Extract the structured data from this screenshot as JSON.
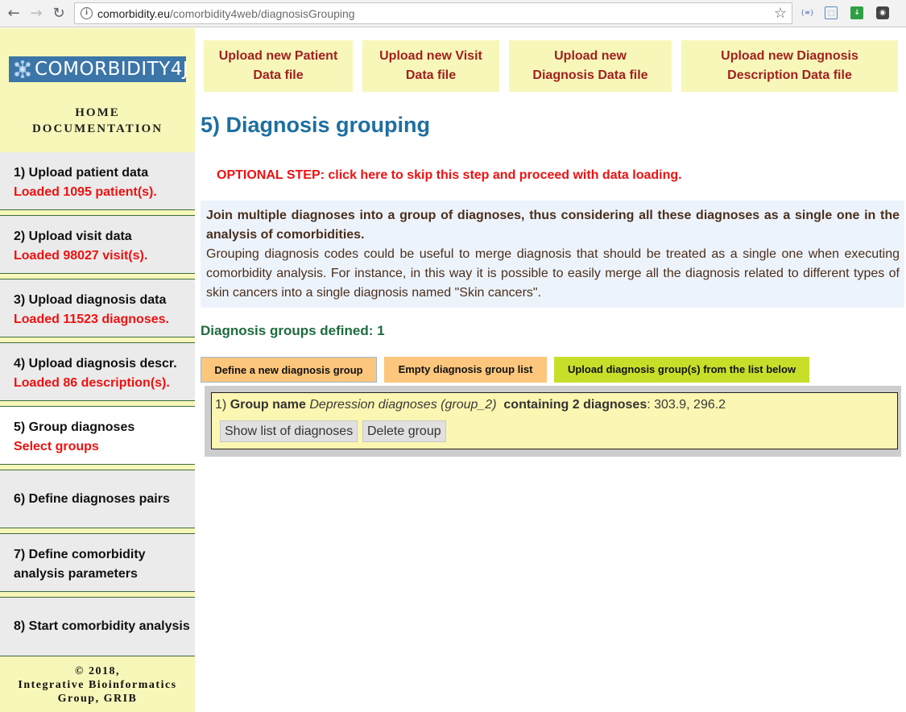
{
  "browser": {
    "url_domain": "comorbidity.eu",
    "url_path": "/comorbidity4web/diagnosisGrouping",
    "ext1_label": "{≡}"
  },
  "sidebar": {
    "logo_text": "COMORBIDITY4J",
    "home_label": "HOME",
    "documentation_label": "DOCUMENTATION",
    "steps": [
      {
        "title": "1) Upload patient data",
        "status": "Loaded 1095 patient(s)."
      },
      {
        "title": "2) Upload visit data",
        "status": "Loaded 98027 visit(s)."
      },
      {
        "title": "3) Upload diagnosis data",
        "status": "Loaded 11523 diagnoses."
      },
      {
        "title": "4) Upload diagnosis descr.",
        "status": "Loaded 86 description(s)."
      },
      {
        "title": "5) Group diagnoses",
        "status": "Select groups"
      },
      {
        "title": "6) Define diagnoses pairs",
        "status": ""
      },
      {
        "title": "7) Define comorbidity",
        "title2": "analysis parameters",
        "status": ""
      },
      {
        "title": "8) Start comorbidity analysis",
        "status": ""
      }
    ],
    "footer_line1": "© 2018,",
    "footer_line2": "Integrative Bioinformatics",
    "footer_line3": "Group, GRIB"
  },
  "upload_buttons": [
    {
      "line1": "Upload new Patient",
      "line2": "Data file"
    },
    {
      "line1": "Upload new Visit",
      "line2": "Data file"
    },
    {
      "line1": "Upload new",
      "line2": "Diagnosis Data file"
    },
    {
      "line1": "Upload new Diagnosis",
      "line2": "Description Data file"
    }
  ],
  "main": {
    "title": "5) Diagnosis grouping",
    "optional_step": "OPTIONAL STEP: click here to skip this step and proceed with data loading.",
    "info_bold": "Join multiple diagnoses into a group of diagnoses, thus considering all these diagnoses as a single one in the analysis of comorbidities.",
    "info_text": "Grouping diagnosis codes could be useful to merge diagnosis that should be treated as a single one when executing comorbidity analysis. For instance, in this way it is possible to easily merge all the diagnosis related to different types of skin cancers into a single diagnosis named \"Skin cancers\".",
    "groups_defined_label": "Diagnosis groups defined: 1",
    "btn_define": "Define a new diagnosis group",
    "btn_empty": "Empty diagnosis group list",
    "btn_upload": "Upload diagnosis group(s) from the list below",
    "group": {
      "index": "1)",
      "name_label": "Group name",
      "name_value": "Depression diagnoses (group_2)",
      "containing_label": "containing 2 diagnoses",
      "codes": ": 303.9, 296.2",
      "show_btn": "Show list of diagnoses",
      "delete_btn": "Delete group"
    }
  }
}
